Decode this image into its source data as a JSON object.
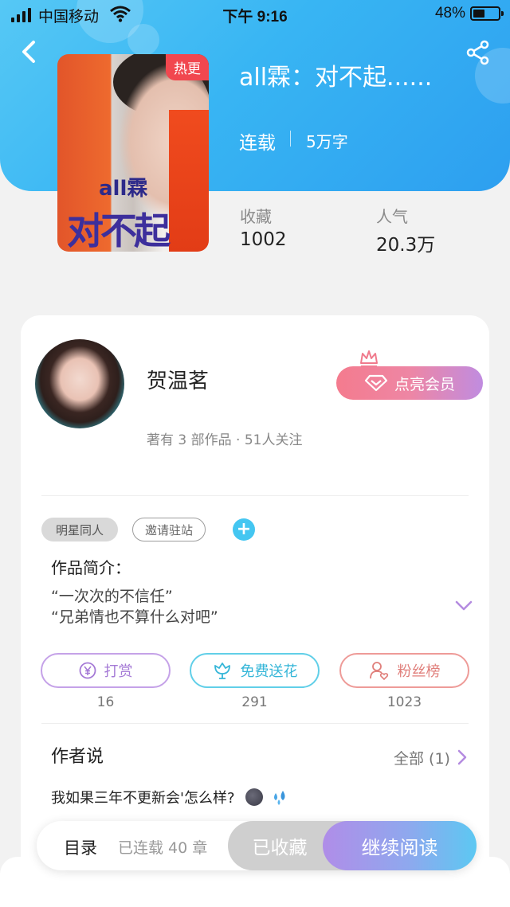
{
  "status_bar": {
    "carrier": "中国移动",
    "time": "下午 9:16",
    "battery": "48%"
  },
  "book": {
    "cover_badge": "热更",
    "cover_title_line1": "all霖",
    "cover_title_line2": "对不起",
    "title": "all霖：对不起......",
    "status": "连载",
    "word_count": "5万字",
    "stats": [
      {
        "label": "收藏",
        "value": "1002"
      },
      {
        "label": "人气",
        "value": "20.3万"
      }
    ]
  },
  "author": {
    "name": "贺温茗",
    "meta": "著有 3 部作品 · 51人关注",
    "vip_button": "点亮会员"
  },
  "tags": [
    "明星同人",
    "邀请驻站"
  ],
  "tag_add": "+",
  "intro": {
    "label": "作品简介：",
    "lines": [
      "“一次次的不信任”",
      "“兄弟情也不算什么对吧”"
    ]
  },
  "actions": [
    {
      "label": "打赏",
      "count": "16",
      "icon": "yen-icon"
    },
    {
      "label": "免费送花",
      "count": "291",
      "icon": "flower-icon"
    },
    {
      "label": "粉丝榜",
      "count": "1023",
      "icon": "fan-user-icon"
    }
  ],
  "author_says": {
    "title": "作者说",
    "all_link": "全部 (1)",
    "post": "我如果三年不更新会'怎么样?"
  },
  "bottom_bar": {
    "toc": "目录",
    "toc_count": "已连载 40 章",
    "collected": "已收藏",
    "continue": "继续阅读"
  },
  "colors": {
    "header_blue": "#38b5f3",
    "hot_badge": "#f1474f",
    "tip_purple": "#a57ad6",
    "flower_cyan": "#35b6d8",
    "fans_red": "#e07f7b"
  }
}
